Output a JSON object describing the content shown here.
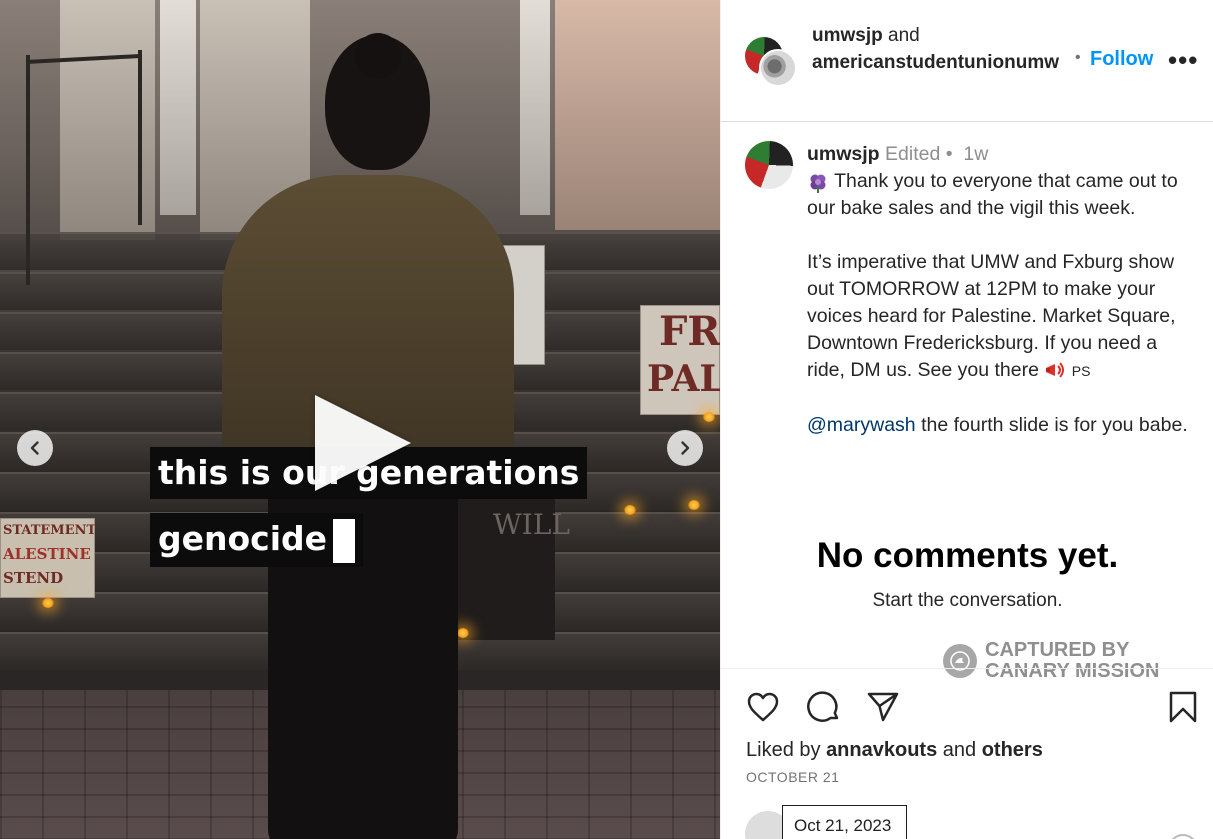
{
  "media": {
    "caption_line1": "this is our generations",
    "caption_line2": "genocide",
    "prev_icon": "chevron-left-icon",
    "next_icon": "chevron-right-icon",
    "play_icon": "play-icon"
  },
  "header": {
    "user1": "umwsjp",
    "and_text": " and",
    "user2": "americanstudentunionumw",
    "dot": "•",
    "follow_label": "Follow",
    "more_label": "•••"
  },
  "post": {
    "username": "umwsjp",
    "edited": "Edited",
    "dot": "•",
    "time": "1w",
    "line1": " Thank you to everyone that came out to our bake sales and the vigil this week.",
    "para2": "It’s imperative that UMW and Fxburg show out TOMORROW at 12PM to make your voices heard for Palestine. Market Square, Downtown Fredericksburg. If you need a ride, DM us. See you there ",
    "ps": "PS",
    "mention": "@marywash",
    "para3_rest": " the fourth slide is for you babe."
  },
  "comments": {
    "empty_title": "No comments yet.",
    "empty_sub": "Start the conversation."
  },
  "watermark": {
    "line1": "CAPTURED BY",
    "line2": "CANARY MISSION"
  },
  "actions": {
    "like_icon": "heart-icon",
    "comment_icon": "comment-icon",
    "share_icon": "send-icon",
    "save_icon": "bookmark-icon",
    "liked_prefix": "Liked by ",
    "liked_user": "annavkouts",
    "liked_and": " and ",
    "liked_others": "others",
    "date": "OCTOBER 21",
    "tooltip_date": "Oct 21, 2023"
  },
  "colors": {
    "accent": "#0095f6",
    "mention": "#00376b",
    "text": "#262626",
    "muted": "#737373"
  }
}
